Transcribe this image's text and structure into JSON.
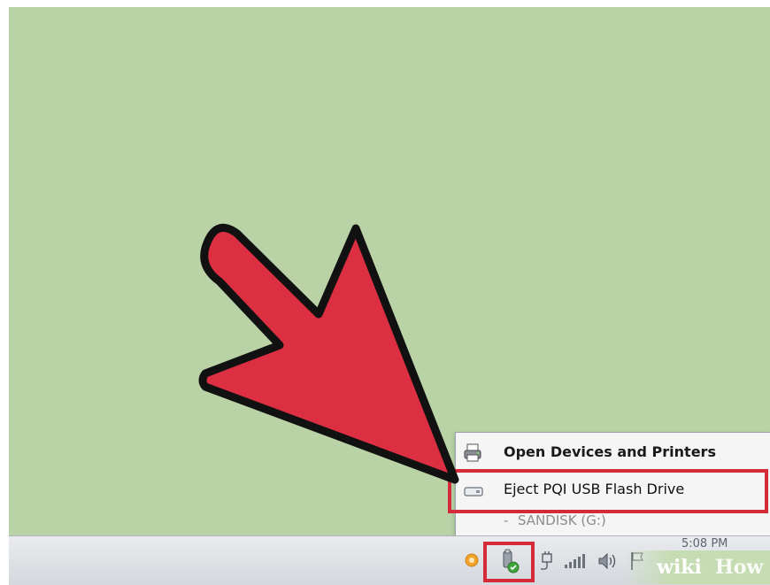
{
  "context_menu": {
    "open_devices_label": "Open Devices and Printers",
    "eject_label": "Eject PQI USB Flash Drive",
    "sub_item_prefix": "-",
    "sub_item_label": "SANDISK (G:)"
  },
  "taskbar": {
    "clock_text": "5:08 PM"
  },
  "watermark": {
    "wiki": "wiki",
    "how": "How"
  },
  "colors": {
    "desktop": "#b9d2a6",
    "highlight": "#d42a3a",
    "arrow": "#dc2f41"
  },
  "icons": [
    "printer-icon",
    "usb-drive-icon",
    "safely-remove-hardware-icon",
    "power-icon",
    "network-signal-icon",
    "volume-icon",
    "action-center-flag-icon",
    "orange-app-icon"
  ]
}
